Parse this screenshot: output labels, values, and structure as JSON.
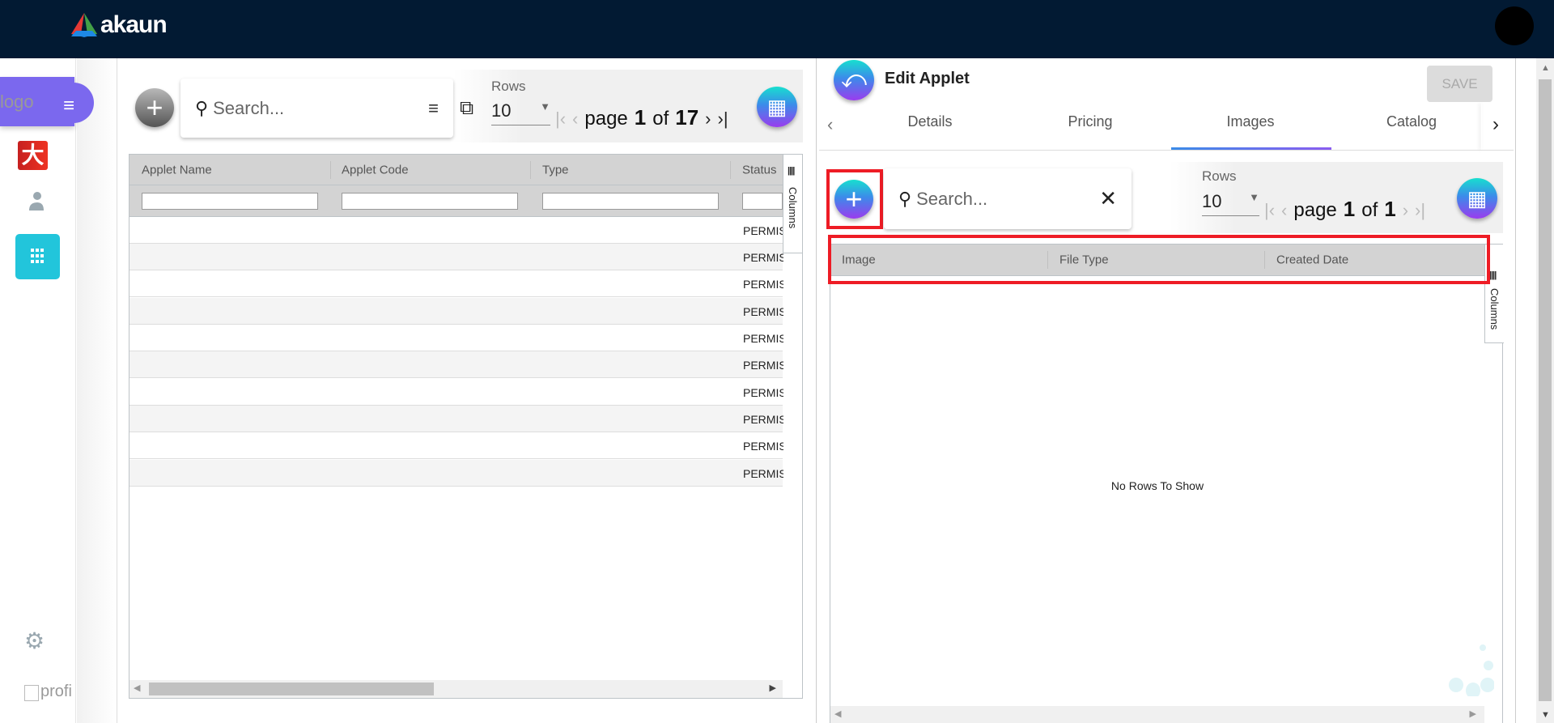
{
  "header": {
    "brand": "akaun",
    "brand_colors": [
      "#e53935",
      "#43a047",
      "#1e88e5"
    ],
    "avatar": "user-avatar"
  },
  "sidebar": {
    "logo_alt": "logo",
    "items": [
      {
        "icon": "app-icon-red"
      },
      {
        "icon": "person-icon"
      },
      {
        "icon": "apps-grid-icon",
        "active": true
      }
    ],
    "settings_icon": "gear-icon",
    "profile_alt": "profi"
  },
  "left_panel": {
    "search_placeholder": "Search...",
    "rows_label": "Rows",
    "rows_value": "10",
    "page_word": "page",
    "page": "1",
    "of_word": "of",
    "total_pages": "17",
    "columns": [
      "Applet Name",
      "Applet Code",
      "Type",
      "Status"
    ],
    "rows": [
      "PERMISSION",
      "PERMISSION",
      "PERMISSION",
      "PERMISSION",
      "PERMISSION",
      "PERMISSION",
      "PERMISSION",
      "PERMISSION",
      "PERMISSION",
      "PERMISSION"
    ],
    "side_panel": "Columns"
  },
  "right_panel": {
    "title": "Edit Applet",
    "save_label": "SAVE",
    "tabs": [
      {
        "label": "Details"
      },
      {
        "label": "Pricing"
      },
      {
        "label": "Images",
        "active": true
      },
      {
        "label": "Catalog"
      }
    ],
    "search_placeholder": "Search...",
    "rows_label": "Rows",
    "rows_value": "10",
    "page_word": "page",
    "page": "1",
    "of_word": "of",
    "total_pages": "1",
    "columns": [
      "Image",
      "File Type",
      "Created Date"
    ],
    "empty_message": "No Rows To Show",
    "side_panel": "Columns",
    "highlight_color": "#ee1c25"
  }
}
